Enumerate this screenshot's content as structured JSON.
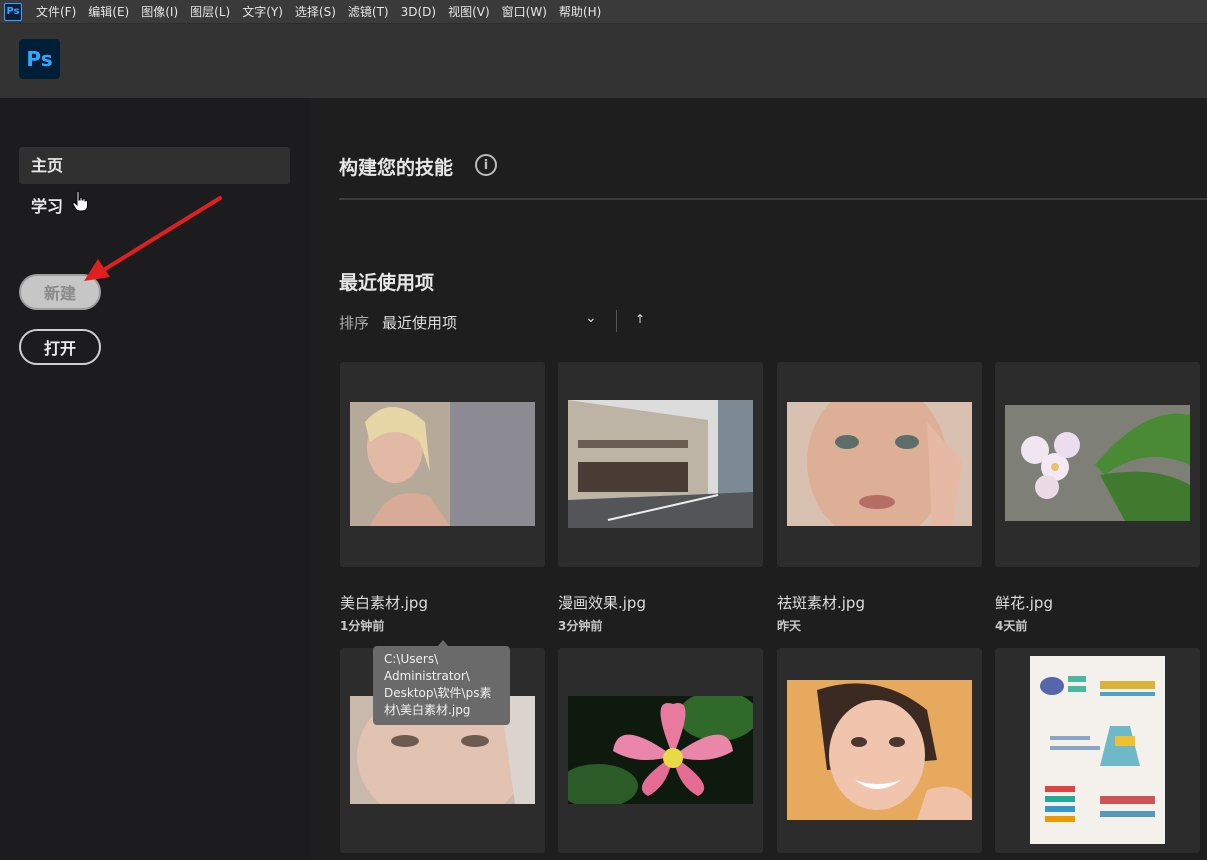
{
  "menubar": {
    "app_icon": "Ps",
    "items": [
      "文件(F)",
      "编辑(E)",
      "图像(I)",
      "图层(L)",
      "文字(Y)",
      "选择(S)",
      "滤镜(T)",
      "3D(D)",
      "视图(V)",
      "窗口(W)",
      "帮助(H)"
    ]
  },
  "header": {
    "logo": "Ps"
  },
  "sidebar": {
    "home_label": "主页",
    "learn_label": "学习",
    "new_label": "新建",
    "open_label": "打开"
  },
  "main": {
    "skills_title": "构建您的技能",
    "info_icon": "i",
    "recent_title": "最近使用项",
    "sort_label": "排序",
    "sort_value": "最近使用项",
    "sort_chevron": "⌄",
    "sort_up": "↑"
  },
  "files": [
    {
      "name": "美白素材.jpg",
      "time": "1分钟前"
    },
    {
      "name": "漫画效果.jpg",
      "time": "3分钟前"
    },
    {
      "name": "祛斑素材.jpg",
      "time": "昨天"
    },
    {
      "name": "鲜花.jpg",
      "time": "4天前"
    }
  ],
  "tooltip": {
    "lines": [
      "C:\\Users\\",
      "Administrator\\",
      "Desktop\\软件\\ps素",
      "材\\美白素材.jpg"
    ]
  },
  "colors": {
    "accent_blue": "#31a8ff",
    "logo_bg": "#001e36",
    "arrow_red": "#e02020"
  }
}
